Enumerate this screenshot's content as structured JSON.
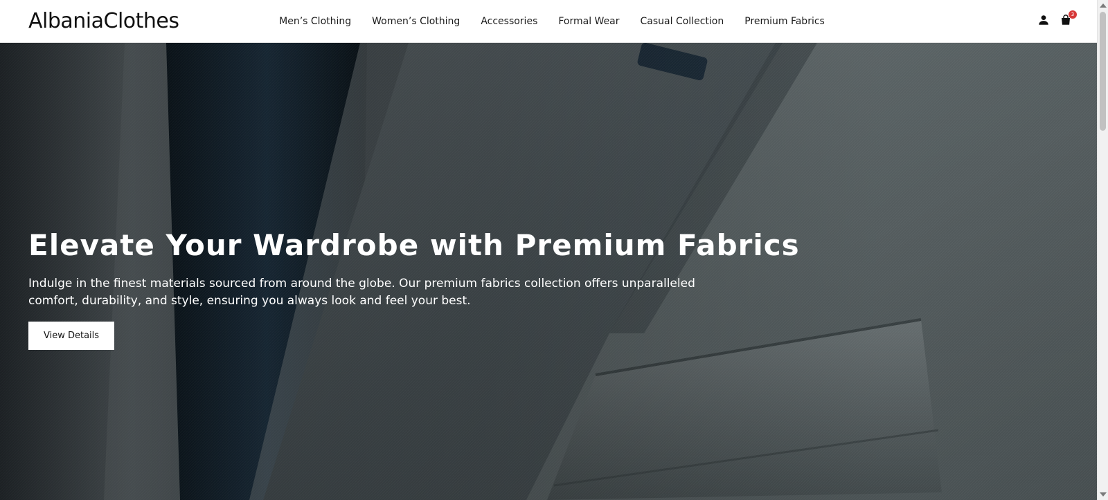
{
  "brand": {
    "name": "AlbaniaClothes"
  },
  "nav": {
    "items": [
      {
        "label": "Men’s Clothing"
      },
      {
        "label": "Women’s Clothing"
      },
      {
        "label": "Accessories"
      },
      {
        "label": "Formal Wear"
      },
      {
        "label": "Casual Collection"
      },
      {
        "label": "Premium Fabrics"
      }
    ]
  },
  "header_icons": {
    "account_icon": "user-icon",
    "cart_icon": "shopping-bag-icon",
    "cart_count": "3",
    "badge_color": "#d73a3a"
  },
  "hero": {
    "title": "Elevate Your Wardrobe with Premium Fabrics",
    "description": "Indulge in the finest materials sourced from around the globe. Our premium fabrics collection offers unparalleled comfort, durability, and style, ensuring you always look and feel your best.",
    "cta_label": "View Details",
    "background_subject": "grey suit jacket close-up"
  },
  "colors": {
    "header_bg": "#ffffff",
    "text_dark": "#111111",
    "hero_text": "#ffffff",
    "button_bg": "#ffffff"
  }
}
